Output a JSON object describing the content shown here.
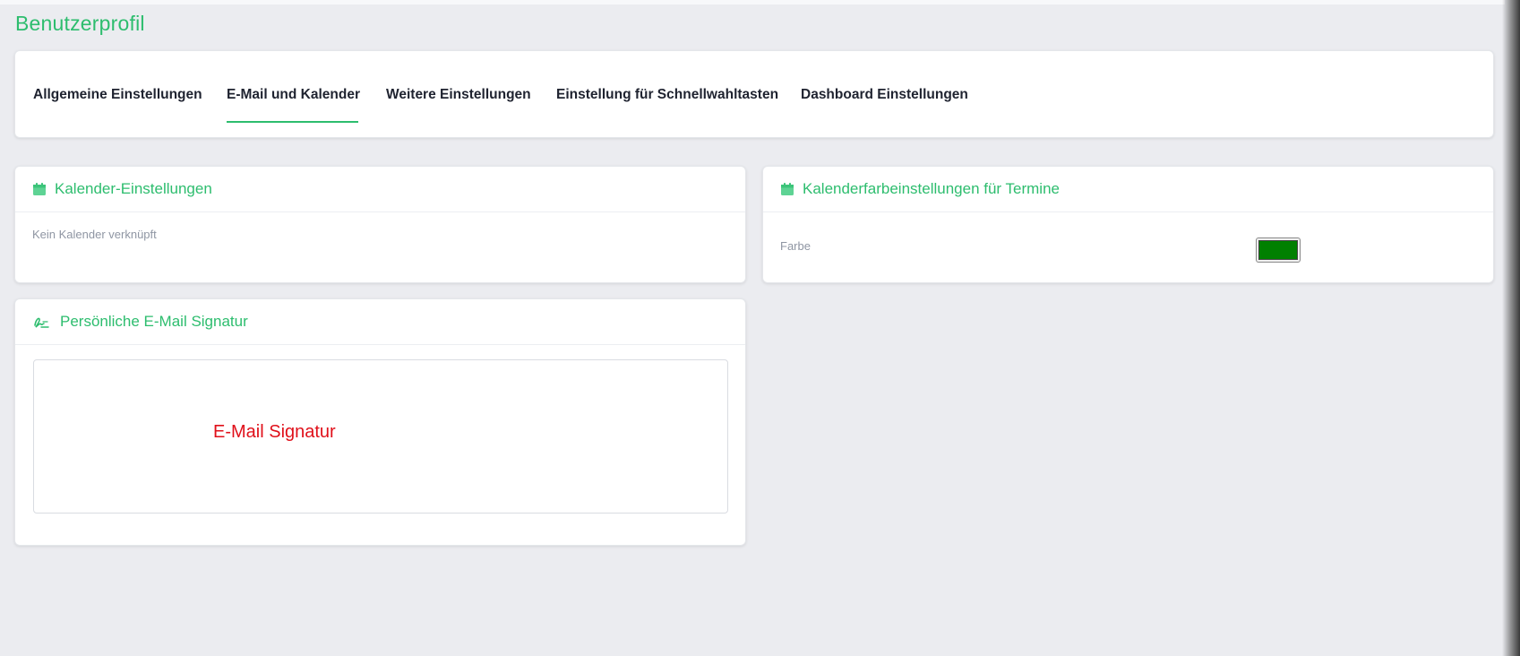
{
  "page": {
    "title": "Benutzerprofil"
  },
  "tabs": [
    {
      "label": "Allgemeine Einstellungen",
      "active": false
    },
    {
      "label": "E-Mail und Kalender",
      "active": true
    },
    {
      "label": "Weitere Einstellungen",
      "active": false
    },
    {
      "label": "Einstellung für Schnellwahltasten",
      "active": false
    },
    {
      "label": "Dashboard Einstellungen",
      "active": false
    }
  ],
  "calendar_settings": {
    "icon": "calendar-icon",
    "title": "Kalender-Einstellungen",
    "status": "Kein Kalender verknüpft"
  },
  "calendar_color_settings": {
    "icon": "calendar-icon",
    "title": "Kalenderfarbeinstellungen für Termine",
    "color_label": "Farbe",
    "color_value": "#008000"
  },
  "email_signature": {
    "icon": "signature-icon",
    "title": "Persönliche E-Mail Signatur",
    "signature_text": "E-Mail Signatur",
    "signature_color": "#e0101a"
  },
  "colors": {
    "accent": "#2dbd6e",
    "background": "#ebecf0",
    "text_dark": "#1f2330",
    "text_muted": "#8f96a3"
  }
}
